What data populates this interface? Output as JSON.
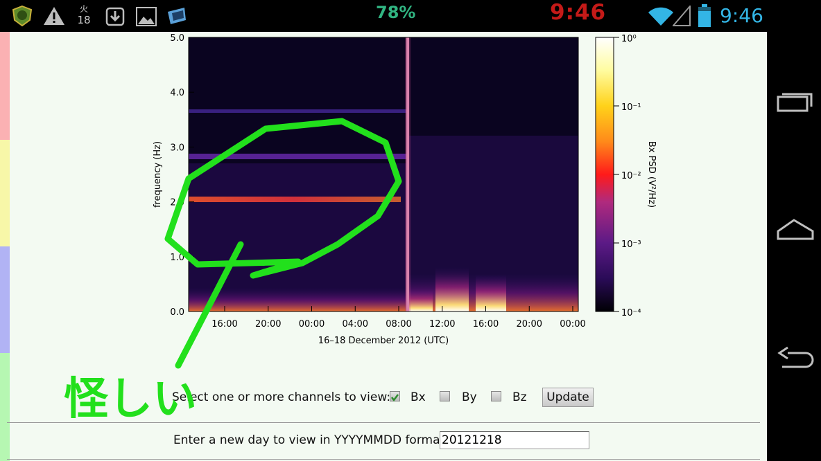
{
  "status_bar": {
    "icons": [
      "app-shield-icon",
      "warning-icon",
      "calendar-icon",
      "download-icon",
      "image-icon",
      "app-blue-icon",
      "wifi-icon",
      "signal-icon",
      "battery-icon"
    ],
    "calendar_day_char": "火",
    "calendar_day_num": "18",
    "battery_percent": "78%",
    "big_clock": "9:46",
    "system_clock": "9:46"
  },
  "nav_bar": {
    "icons": [
      "recent-apps-icon",
      "home-icon",
      "back-icon"
    ]
  },
  "chart_data": {
    "type": "heatmap",
    "title": "",
    "xlabel": "16–18 December 2012 (UTC)",
    "ylabel": "frequency (Hz)",
    "x_tick_labels": [
      "16:00",
      "20:00",
      "00:00",
      "04:00",
      "08:00",
      "12:00",
      "16:00",
      "20:00",
      "00:00"
    ],
    "y_tick_labels": [
      "0.0",
      "1.0",
      "2.0",
      "3.0",
      "4.0",
      "5.0"
    ],
    "ylim": [
      0,
      5
    ],
    "colorbar": {
      "label": "Bx PSD (V²/Hz)",
      "scale": "log",
      "tick_labels": [
        "10⁰",
        "10⁻¹",
        "10⁻²",
        "10⁻³",
        "10⁻⁴"
      ],
      "range": [
        0.0001,
        1
      ]
    },
    "features": [
      {
        "type": "band",
        "frequency_hz": 2.05,
        "from": "14:00",
        "to": "08:00"
      },
      {
        "type": "band",
        "frequency_hz": 2.85,
        "from": "14:00",
        "to": "08:00"
      },
      {
        "type": "band",
        "frequency_hz": 3.65,
        "from": "14:00",
        "to": "08:00"
      },
      {
        "type": "vertical_burst",
        "at": "08:50"
      }
    ]
  },
  "controls": {
    "prompt": "Select one or more channels to view:",
    "channels": [
      {
        "label": "Bx",
        "checked": true
      },
      {
        "label": "By",
        "checked": false
      },
      {
        "label": "Bz",
        "checked": false
      }
    ],
    "update_label": "Update"
  },
  "date_entry": {
    "label": "Enter a new day to view in YYYYMMDD format:",
    "value": "20121218"
  },
  "annotation": {
    "text": "怪しい",
    "color": "#22e01c"
  },
  "colors": {
    "page_bg": "#f3faf2",
    "plot_bg": "#0a0420",
    "annotation": "#22e01c",
    "battery_text": "#31b582",
    "big_clock": "#c41a18",
    "system_clock": "#33b5e5"
  }
}
